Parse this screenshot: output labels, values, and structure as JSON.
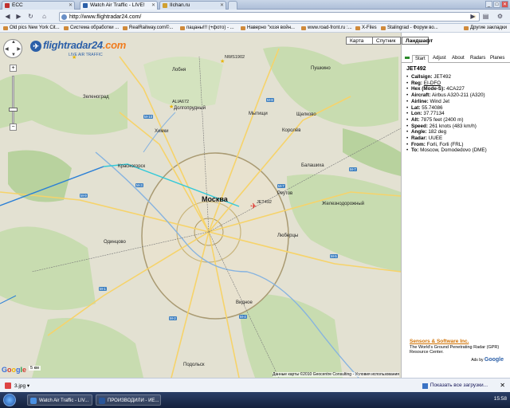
{
  "browser": {
    "tabs": [
      {
        "label": "ECC",
        "active": false,
        "color": "#c03030"
      },
      {
        "label": "Watch Air Traffic - LIVE!",
        "active": true,
        "color": "#2b5fa8"
      },
      {
        "label": "IIchan.ru",
        "active": false,
        "color": "#d0a030"
      }
    ],
    "url": "http://www.flightradar24.com/",
    "bookmarks": [
      "Old pics New York Cit...",
      "Система обработки ...",
      "RealRailway.com©...",
      "пацаны!!! (+фото) - ...",
      "Наверно \"хозя войн...",
      "www.road-front.ru :...",
      "X-Files",
      "Stalingrad - Форум во...",
      "Другие закладки"
    ]
  },
  "map": {
    "logo_text": "flightradar24",
    "logo_suffix": ".com",
    "logo_subtitle": "LIVE AIR TRAFFIC",
    "map_types": [
      "Карта",
      "Спутник",
      "Ландшафт"
    ],
    "active_map_type": "Ландшафт",
    "main_city": "Москва",
    "cities": [
      "Химки",
      "Мытищи",
      "Балашиха",
      "Красногорск",
      "Реутов",
      "Люберцы",
      "Одинцово",
      "Подольск",
      "Видное",
      "Железнодорожный",
      "Щелково",
      "Королёв",
      "Долгопрудный",
      "Лобня",
      "Пушкино",
      "Зеленоград"
    ],
    "flight_labels": [
      "JET492",
      "ALIA672",
      "NWS1902"
    ],
    "road_labels": [
      "M-10",
      "M-8",
      "M-7",
      "M-9",
      "M-4",
      "M-2",
      "M-1",
      "M-5",
      "M-3"
    ],
    "scale_text": "5 км",
    "google_text": "Google",
    "terms_text": "Данные карты ©2010 Geocentre Consulting - Условия использования"
  },
  "panel": {
    "tabs": [
      "Start",
      "Adjust",
      "About",
      "Radars",
      "Planes"
    ],
    "active_tab": "Start",
    "flight_title": "JET492",
    "info": [
      {
        "label": "Callsign:",
        "value": "JET492"
      },
      {
        "label": "Reg:",
        "value": "EI-DFO"
      },
      {
        "label": "Hex (Mode-S):",
        "value": "4CA227"
      },
      {
        "label": "Aircraft:",
        "value": "Airbus A320-211 (A320)"
      },
      {
        "label": "Airline:",
        "value": "Wind Jet"
      },
      {
        "label": "Lat:",
        "value": "55.74086"
      },
      {
        "label": "Lon:",
        "value": "37.77134"
      },
      {
        "label": "Alt:",
        "value": "7875 feet (2400 m)"
      },
      {
        "label": "Speed:",
        "value": "261 knots (483 km/h)"
      },
      {
        "label": "Angle:",
        "value": "182 deg"
      },
      {
        "label": "Radar:",
        "value": "UUEE"
      },
      {
        "label": "From:",
        "value": "Forli, Forli (FRL)"
      },
      {
        "label": "To:",
        "value": "Moscow, Domodedovo (DME)"
      }
    ],
    "ad_title": "Sensors & Software Inc.",
    "ad_text": "The World's Ground Penetrating Radar (GPR) Resource Center.",
    "ads_by": "Ads by",
    "ads_by_brand": "Google"
  },
  "download_bar": {
    "file": "3.jpg",
    "show_all": "Показать все загрузки...",
    "close": "✕"
  },
  "taskbar": {
    "items": [
      "Watch Air Traffic - LIV...",
      "ПРОИЗВОДИЛИ - ИЕ..."
    ],
    "clock": "15:58"
  },
  "colors": {
    "accent": "#2b5fa8",
    "logo_orange": "#f07c1e",
    "road_blue": "#3d7fc0",
    "track_cyan": "#33c9d8",
    "plane_red": "#e0302a"
  }
}
